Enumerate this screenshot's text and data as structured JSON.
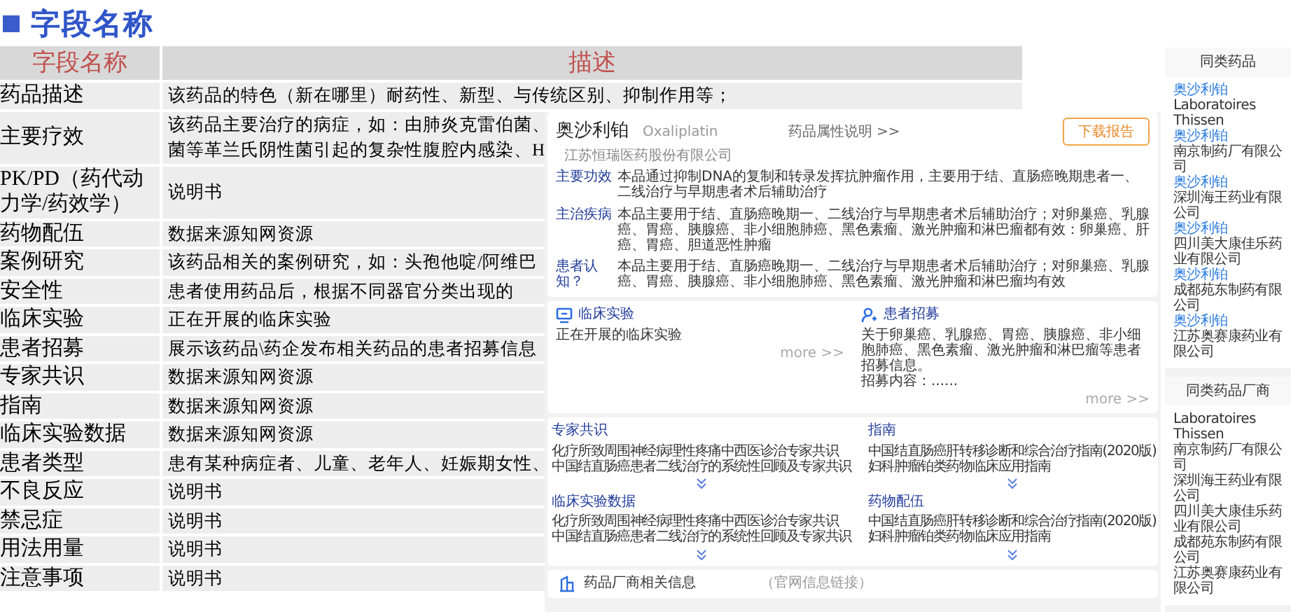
{
  "title": "字段名称",
  "table": {
    "columns": [
      "字段名称",
      "描述"
    ],
    "rows": [
      {
        "field": "药品描述",
        "description": "该药品的特色（新在哪里）耐药性、新型、与传统区别、抑制作用等；"
      },
      {
        "field": "主要疗效",
        "description": "该药品主要治疗的病症，如：由肺炎克雷伯菌、",
        "description_line_2": "菌等革兰氏阴性菌引起的复杂性腹腔内感染、H"
      },
      {
        "field": "PK/PD（药代动力学/药效学）",
        "description": "说明书"
      },
      {
        "field": "药物配伍",
        "description": "数据来源知网资源"
      },
      {
        "field": "案例研究",
        "description": "该药品相关的案例研究，如：头孢他啶/阿维巴"
      },
      {
        "field": "安全性",
        "description": "患者使用药品后，根据不同器官分类出现的"
      },
      {
        "field": "临床实验",
        "description": "正在开展的临床实验"
      },
      {
        "field": "患者招募",
        "description": "展示该药品\\药企发布相关药品的患者招募信息"
      },
      {
        "field": "专家共识",
        "description": "数据来源知网资源"
      },
      {
        "field": "指南",
        "description": "数据来源知网资源"
      },
      {
        "field": "临床实验数据",
        "description": "数据来源知网资源"
      },
      {
        "field": "患者类型",
        "description": "患有某种病症者、儿童、老年人、妊娠期女性、"
      },
      {
        "field": "不良反应",
        "description": "说明书"
      },
      {
        "field": "禁忌症",
        "description": "说明书"
      },
      {
        "field": "用法用量",
        "description": "说明书"
      },
      {
        "field": "注意事项",
        "description": "说明书"
      }
    ]
  },
  "drug_card": {
    "name": "奥沙利铂",
    "latin_name": "Oxaliplatin",
    "attributes_link": "药品属性说明 >>",
    "download_button": "下载报告",
    "company": "江苏恒瑞医药股份有限公司",
    "items": [
      {
        "label": "主要功效",
        "text": "本品通过抑制DNA的复制和转录发挥抗肿瘤作用，主要用于结、直肠癌晚期患者一、二线治疗与早期患者术后辅助治疗"
      },
      {
        "label": "主治疾病",
        "text": "本品主要用于结、直肠癌晚期一、二线治疗与早期患者术后辅助治疗；对卵巢癌、乳腺癌、胃癌、胰腺癌、非小细胞肺癌、黑色素瘤、激光肿瘤和淋巴瘤都有效：卵巢癌、肝癌、胃癌、胆道恶性肿瘤"
      },
      {
        "label": "患者认知？",
        "text": "本品主要用于结、直肠癌晚期一、二线治疗与早期患者术后辅助治疗；对卵巢癌、乳腺癌、胃癌、胰腺癌、非小细胞肺癌、黑色素瘤、激光肿瘤和淋巴瘤均有效"
      }
    ]
  },
  "trial_panels": [
    {
      "kind": "monitor",
      "title": "临床实验",
      "lines": [
        "正在开展的临床实验"
      ],
      "more": "more >>"
    },
    {
      "kind": "person",
      "title": "患者招募",
      "lines": [
        "关于卵巢癌、乳腺癌、胃癌、胰腺癌、非小细胞肺癌、黑色素瘤、激光肿瘤和淋巴瘤等患者招募信息。",
        "招募内容：......"
      ],
      "more": "more >>"
    }
  ],
  "literature": [
    {
      "title": "专家共识",
      "items": [
        "化疗所致周围神经病理性疼痛中西医诊治专家共识",
        "中国结直肠癌患者二线治疗的系统性回顾及专家共识"
      ]
    },
    {
      "title": "指南",
      "items": [
        "中国结直肠癌肝转移诊断和综合治疗指南(2020版)",
        "妇科肿瘤铂类药物临床应用指南"
      ]
    },
    {
      "title": "临床实验数据",
      "items": [
        "化疗所致周围神经病理性疼痛中西医诊治专家共识",
        "中国结直肠癌患者二线治疗的系统性回顾及专家共识"
      ]
    },
    {
      "title": "药物配伍",
      "items": [
        "中国结直肠癌肝转移诊断和综合治疗指南(2020版)",
        "妇科肿瘤铂类药物临床应用指南"
      ]
    }
  ],
  "manufacturer": {
    "title": "药品厂商相关信息",
    "note": "（官网信息链接）"
  },
  "similar_drugs": {
    "title": "同类药品",
    "items": [
      {
        "drug": "奥沙利铂",
        "company": "Laboratoires Thissen"
      },
      {
        "drug": "奥沙利铂",
        "company": "南京制药厂有限公司"
      },
      {
        "drug": "奥沙利铂",
        "company": "深圳海王药业有限公司"
      },
      {
        "drug": "奥沙利铂",
        "company": "四川美大康佳乐药业有限公司"
      },
      {
        "drug": "奥沙利铂",
        "company": "成都苑东制药有限公司"
      },
      {
        "drug": "奥沙利铂",
        "company": "江苏奥赛康药业有限公司"
      }
    ]
  },
  "similar_makers": {
    "title": "同类药品厂商",
    "items": [
      "Laboratoires Thissen",
      "南京制药厂有限公司",
      "深圳海王药业有限公司",
      "四川美大康佳乐药业有限公司",
      "成都苑东制药有限公司",
      "江苏奥赛康药业有限公司"
    ]
  }
}
